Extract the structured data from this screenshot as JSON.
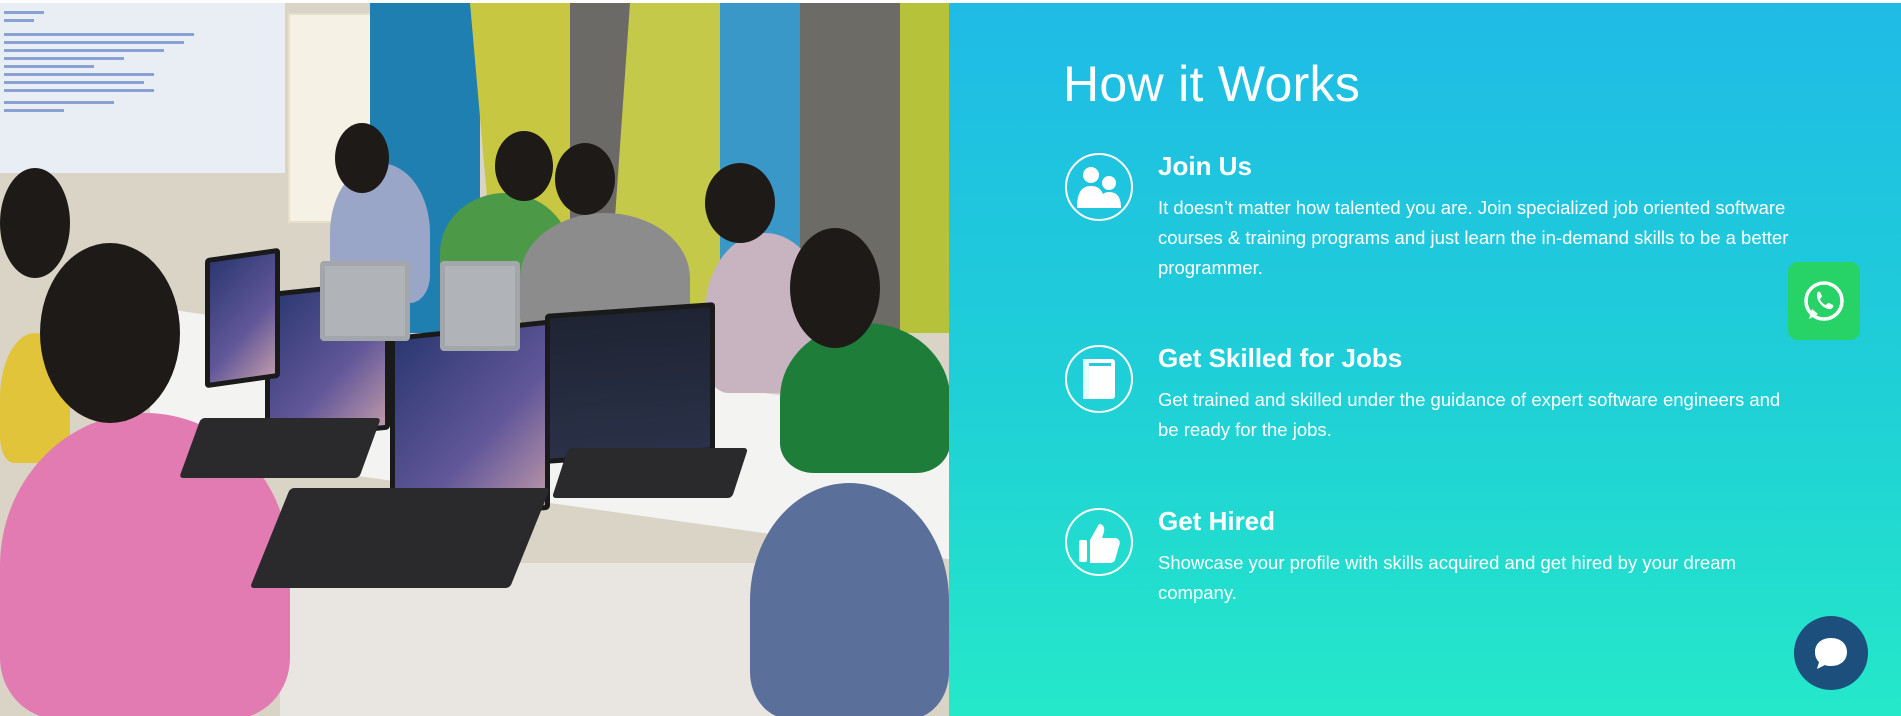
{
  "section": {
    "heading": "How it Works"
  },
  "steps": [
    {
      "icon": "users-icon",
      "title": "Join Us",
      "text": "It doesn’t matter how talented you are. Join specialized job oriented software courses & training programs and just learn the in-demand skills to be a better programmer."
    },
    {
      "icon": "book-icon",
      "title": "Get Skilled for Jobs",
      "text": "Get trained and skilled under the guidance of expert software engineers and be ready for the jobs."
    },
    {
      "icon": "thumbs-up-icon",
      "title": "Get Hired",
      "text": "Showcase your profile with skills acquired and get hired by your dream company."
    }
  ],
  "floating": {
    "whatsapp_icon": "whatsapp-icon",
    "chat_icon": "chat-bubble-icon"
  },
  "colors": {
    "panel_top": "#1fbbe6",
    "panel_bottom": "#25e8c9",
    "whatsapp": "#27d366",
    "chat": "#1c4f7c",
    "text": "#ffffff"
  }
}
